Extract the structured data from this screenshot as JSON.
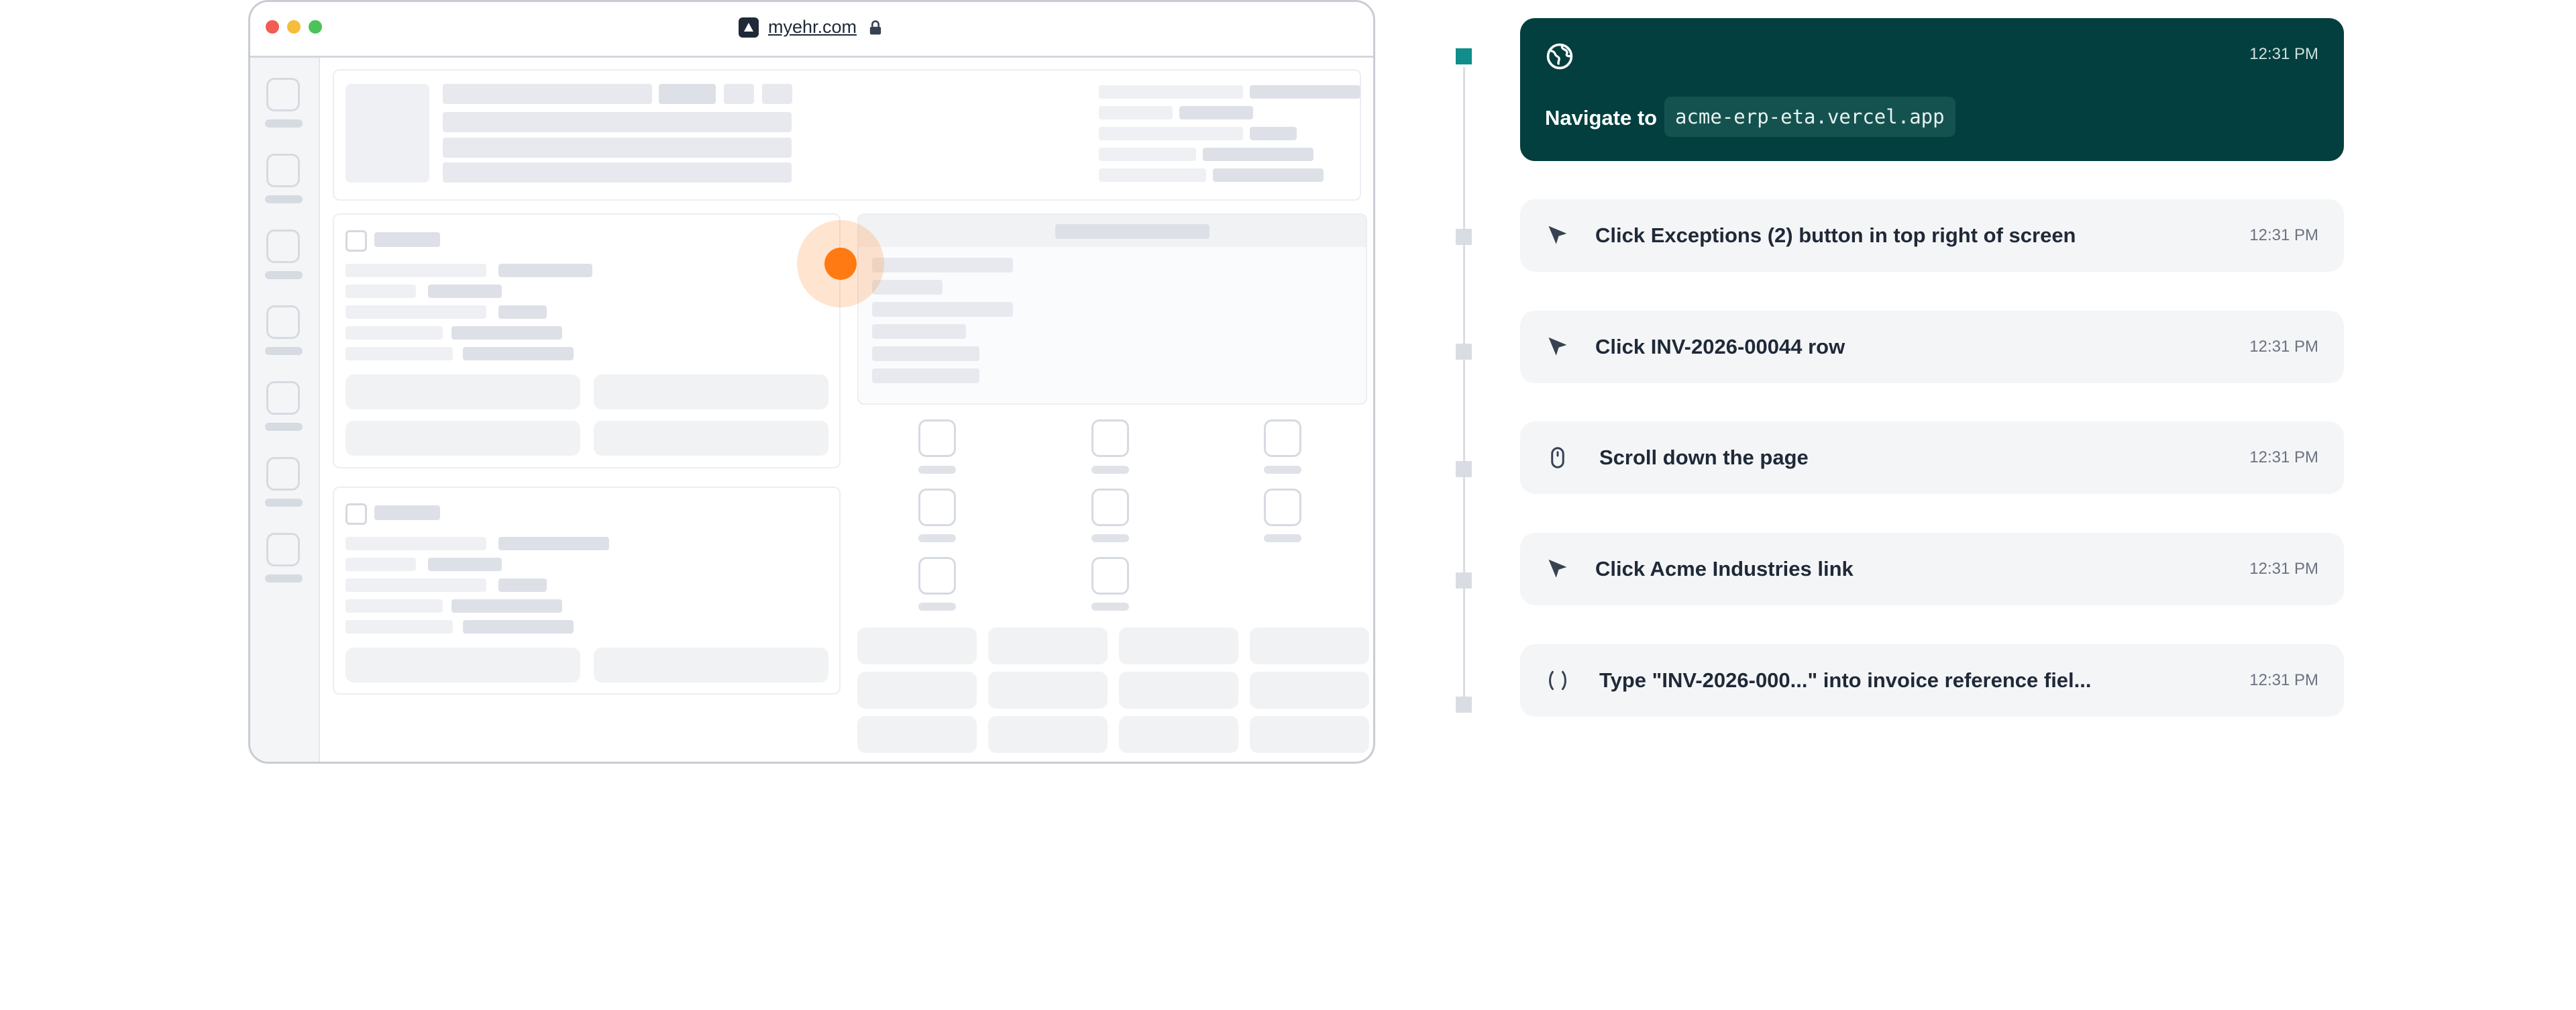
{
  "browser": {
    "url": "myehr.com",
    "site_icon": "app-logo-icon",
    "lock_icon": "lock-icon"
  },
  "timeline": {
    "active_step": {
      "icon": "globe-icon",
      "label": "Navigate to",
      "url": "acme-erp-eta.vercel.app",
      "time": "12:31 PM"
    },
    "steps": [
      {
        "icon": "cursor-icon",
        "label": "Click Exceptions (2) button in top right of screen",
        "time": "12:31 PM"
      },
      {
        "icon": "cursor-icon",
        "label": "Click INV-2026-00044 row",
        "time": "12:31 PM"
      },
      {
        "icon": "mouse-icon",
        "label": "Scroll down the page",
        "time": "12:31 PM"
      },
      {
        "icon": "cursor-icon",
        "label": "Click Acme Industries link",
        "time": "12:31 PM"
      },
      {
        "icon": "type-icon",
        "label": "Type \"INV-2026-000...\" into invoice reference fiel...",
        "time": "12:31 PM"
      }
    ]
  },
  "colors": {
    "active_step_bg": "#023f3e",
    "active_marker": "#0f8e8a",
    "click_indicator": "#ff7a12"
  }
}
